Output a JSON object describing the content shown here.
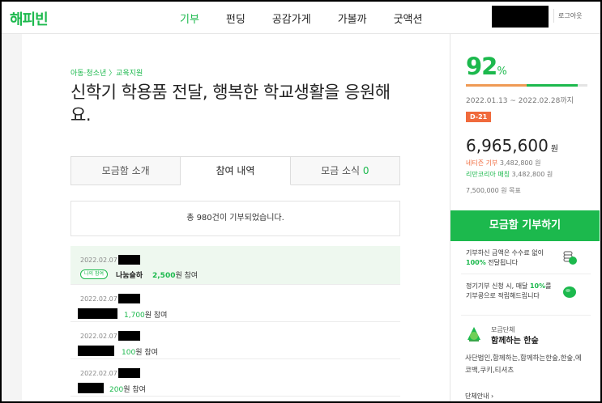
{
  "header": {
    "logo": "해피빈",
    "nav": [
      "기부",
      "펀딩",
      "공감가게",
      "가볼까",
      "굿액션"
    ],
    "logout": "로그아웃"
  },
  "campaign": {
    "breadcrumb": "아동·청소년 〉교육지원",
    "title": "신학기 학용품 전달, 행복한 학교생활을 응원해요."
  },
  "tabs": [
    {
      "label": "모금함 소개",
      "count": ""
    },
    {
      "label": "참여 내역",
      "count": ""
    },
    {
      "label": "모금 소식",
      "count": "0"
    }
  ],
  "total_text": "총 980건이 기부되었습니다.",
  "donations": [
    {
      "date": "2022.02.07",
      "badge": "나의 참여",
      "nickname": "나눔슬하",
      "amount": "2,500",
      "unit": "원 참여"
    },
    {
      "date": "2022.02.07",
      "amount": "1,700",
      "unit": "원 참여"
    },
    {
      "date": "2022.02.07",
      "amount": "100",
      "unit": "원 참여"
    },
    {
      "date": "2022.02.07",
      "amount": "200",
      "unit": "원 참여"
    }
  ],
  "side": {
    "percent": "92",
    "percent_sign": "%",
    "progress": {
      "orange_fraction": 0.5,
      "total_fraction": 0.92
    },
    "period": "2022.01.13 ~ 2022.02.28까지",
    "dday": "D-21",
    "amount": "6,965,600",
    "amount_unit": "원",
    "fund1_label": "네티즌 기부",
    "fund1_value": "3,482,800 원",
    "fund2_label": "리만코리아 매칭",
    "fund2_value": "3,482,800 원",
    "goal": "7,500,000 원 목표",
    "donate_button": "모금함 기부하기",
    "info1_line1": "기부하신 금액은 수수료 없이",
    "info1_bold": "100%",
    "info1_line2": "전달됩니다",
    "info2_line1_a": "정기기부 신청 시, 매달",
    "info2_bold": "10%",
    "info2_line1_b": "를",
    "info2_line2": "기부콩으로 적립해드립니다",
    "group_small": "모금단체",
    "group_title": "함께하는 한숲",
    "group_members": "사단법인,함께하는,함께하는한숲,한숲,에코백,쿠키,티셔츠",
    "group_more": "단체안내 ›"
  },
  "colors": {
    "brand_green": "#1cb94d",
    "dday_orange": "#f06a3c",
    "progress_orange": "#ef9a55"
  }
}
